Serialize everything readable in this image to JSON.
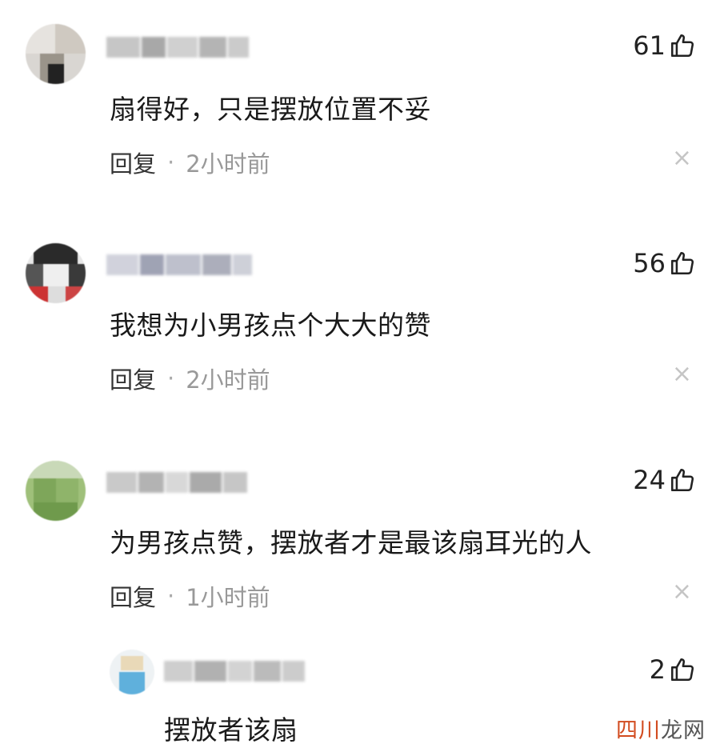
{
  "comments": [
    {
      "like_count": "61",
      "text": "扇得好，只是摆放位置不妥",
      "reply_label": "回复",
      "separator": "·",
      "time": "2小时前",
      "close_symbol": "×"
    },
    {
      "like_count": "56",
      "text": "我想为小男孩点个大大的赞",
      "reply_label": "回复",
      "separator": "·",
      "time": "2小时前",
      "close_symbol": "×"
    },
    {
      "like_count": "24",
      "text": "为男孩点赞，摆放者才是最该扇耳光的人",
      "reply_label": "回复",
      "separator": "·",
      "time": "1小时前",
      "close_symbol": "×"
    },
    {
      "like_count": "2",
      "text": "摆放者该扇"
    }
  ],
  "watermark": {
    "part1": "四川",
    "part2": "龙网"
  },
  "colors": {
    "time_text": "#999999",
    "watermark_red": "#d24b1f",
    "close_icon": "#c5c5c5"
  }
}
